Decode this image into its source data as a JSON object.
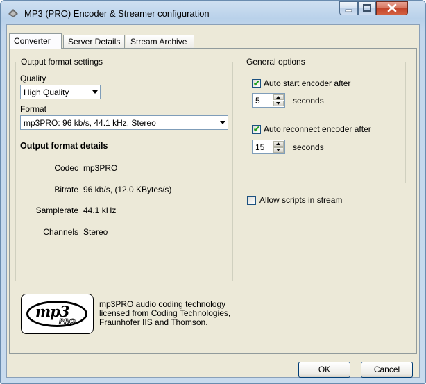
{
  "window": {
    "title": "MP3 (PRO) Encoder & Streamer configuration"
  },
  "tabs": [
    "Converter",
    "Server Details",
    "Stream Archive"
  ],
  "output_format": {
    "group_label": "Output format settings",
    "quality_label": "Quality",
    "quality_value": "High Quality",
    "format_label": "Format",
    "format_value": "mp3PRO: 96 kb/s, 44.1 kHz, Stereo",
    "details_heading": "Output format details",
    "details": [
      {
        "label": "Codec",
        "value": "mp3PRO"
      },
      {
        "label": "Bitrate",
        "value": "96 kb/s, (12.0 KBytes/s)"
      },
      {
        "label": "Samplerate",
        "value": "44.1 kHz"
      },
      {
        "label": "Channels",
        "value": "Stereo"
      }
    ]
  },
  "general": {
    "group_label": "General options",
    "auto_start_label": "Auto start encoder after",
    "auto_start_checked": true,
    "auto_start_seconds": "5",
    "auto_reconnect_label": "Auto reconnect encoder after",
    "auto_reconnect_checked": true,
    "auto_reconnect_seconds": "15",
    "seconds_label": "seconds",
    "allow_scripts_label": "Allow scripts in stream",
    "allow_scripts_checked": false
  },
  "logo": {
    "text": "mp3",
    "sub": "PRO"
  },
  "license_text": "mp3PRO audio coding technology\nlicensed from Coding Technologies,\nFraunhofer IIS and Thomson.",
  "buttons": {
    "ok": "OK",
    "cancel": "Cancel"
  },
  "colors": {
    "check": "#21a121",
    "close_button": "#c2452c",
    "dialog_bg": "#ece9d8"
  }
}
